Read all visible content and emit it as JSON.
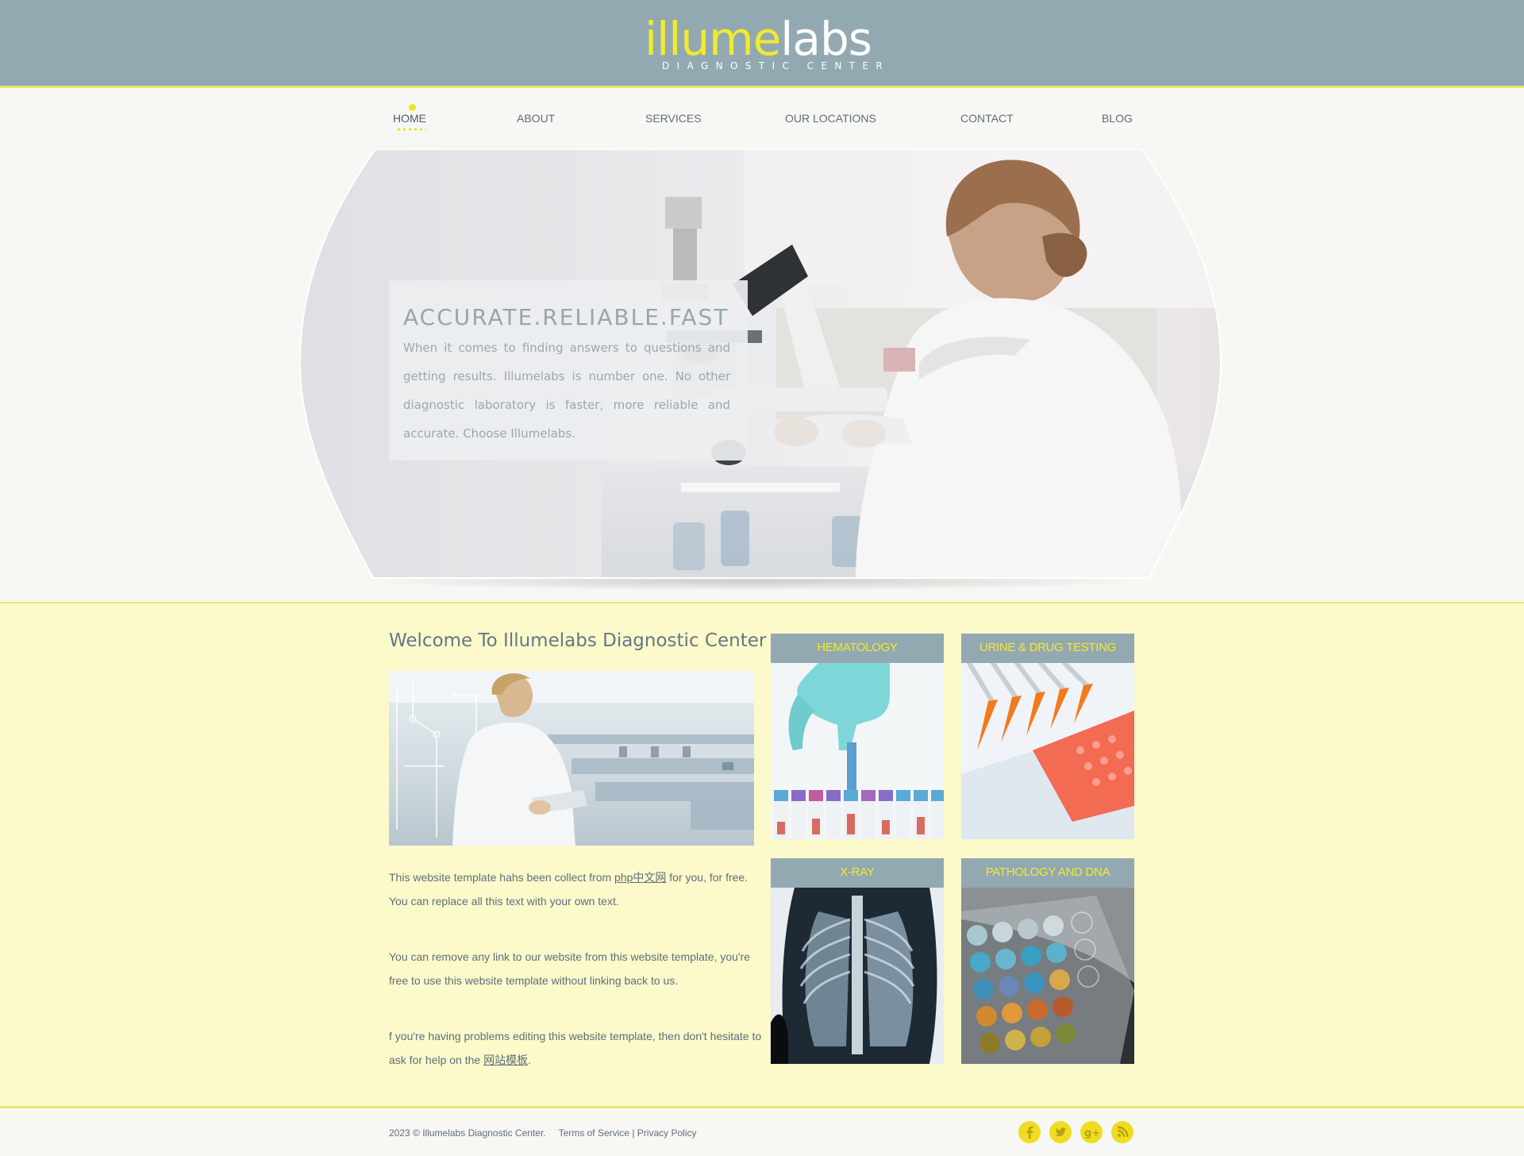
{
  "brand": {
    "logo_part1": "illume",
    "logo_part2": "labs",
    "subtitle": "DIAGNOSTIC CENTER"
  },
  "nav": {
    "items": [
      {
        "label": "HOME",
        "active": true
      },
      {
        "label": "ABOUT"
      },
      {
        "label": "SERVICES"
      },
      {
        "label": "OUR LOCATIONS"
      },
      {
        "label": "CONTACT"
      },
      {
        "label": "BLOG"
      }
    ]
  },
  "hero": {
    "title": "ACCURATE.RELIABLE.FAST",
    "text": "When it comes to finding answers to questions and getting results. Illumelabs is number one. No other diagnostic laboratory is faster, more reliable and accurate. Choose Illumelabs."
  },
  "welcome": {
    "title": "Welcome To Illumelabs Diagnostic Center",
    "p1_before": "This website template hahs been collect from ",
    "p1_link": "php中文网",
    "p1_after": " for you, for free. You can replace all this text with your own text.",
    "p2": "You can remove any link to our website from this website template, you're free to use this website template without linking back to us.",
    "p3_before": "f you're having problems editing this website template, then don't hesitate to ask for help on the ",
    "p3_link": "网站模板",
    "p3_after": "."
  },
  "tiles": [
    {
      "label": "HEMATOLOGY"
    },
    {
      "label": "URINE & DRUG TESTING"
    },
    {
      "label": "X-RAY"
    },
    {
      "label": "PATHOLOGY AND DNA"
    }
  ],
  "footer": {
    "copyright": "2023 © Illumelabs Diagnostic Center.",
    "terms": "Terms of Service",
    "separator": "|",
    "privacy": "Privacy Policy",
    "social_icons": [
      "facebook-icon",
      "twitter-icon",
      "google-plus-icon",
      "rss-icon"
    ]
  },
  "colors": {
    "header_bg": "#93a9b2",
    "accent_yellow": "#f2e02a",
    "main_bg": "#fcf9cb",
    "text": "#5d6f78"
  }
}
